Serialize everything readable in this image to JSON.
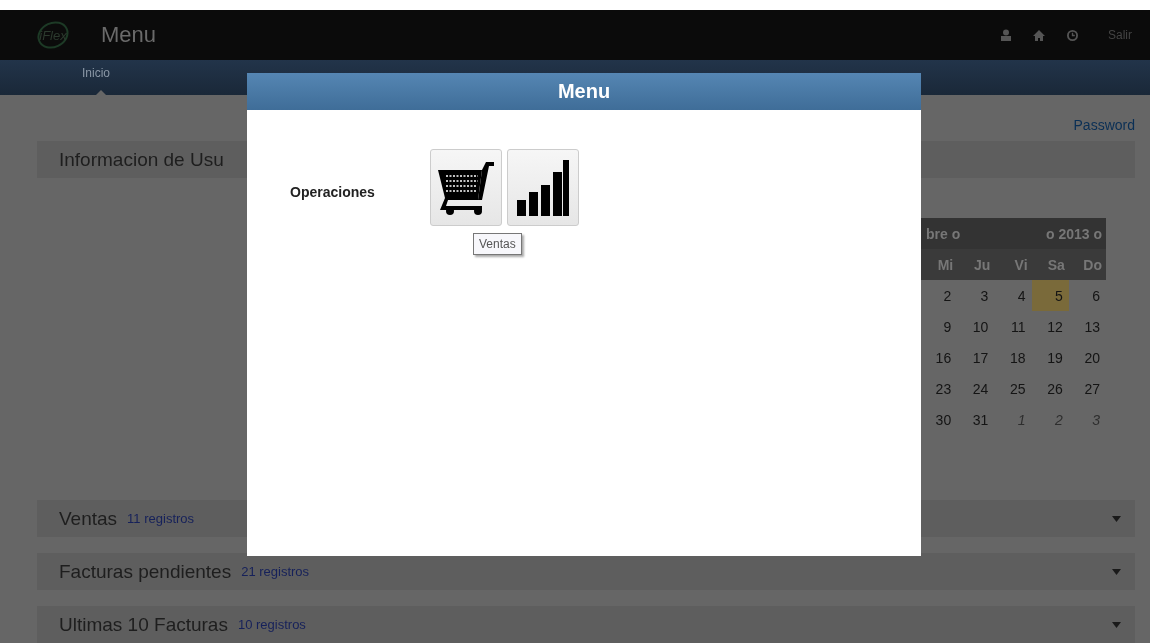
{
  "header": {
    "logo": "iFlex",
    "title": "Menu",
    "actions": [
      {
        "kind": "user"
      },
      {
        "kind": "home"
      },
      {
        "kind": "clock"
      },
      {
        "kind": "text",
        "label": "Salir"
      }
    ]
  },
  "tabs": [
    {
      "label": "Inicio",
      "selected": true
    }
  ],
  "password_link": "Password",
  "info_panel": {
    "title": "Informacion de Usu"
  },
  "calendar": {
    "month": "bre o",
    "year": "o 2013 o",
    "weekdays": [
      "Mi",
      "Ju",
      "Vi",
      "Sa",
      "Do"
    ],
    "weeks": [
      [
        {
          "day": "2",
          "other_month": false,
          "selected": false
        },
        {
          "day": "3",
          "other_month": false,
          "selected": false
        },
        {
          "day": "4",
          "other_month": false,
          "selected": false
        },
        {
          "day": "5",
          "other_month": false,
          "selected": true
        },
        {
          "day": "6",
          "other_month": false,
          "selected": false
        }
      ],
      [
        {
          "day": "9",
          "other_month": false,
          "selected": false
        },
        {
          "day": "10",
          "other_month": false,
          "selected": false
        },
        {
          "day": "11",
          "other_month": false,
          "selected": false
        },
        {
          "day": "12",
          "other_month": false,
          "selected": false
        },
        {
          "day": "13",
          "other_month": false,
          "selected": false
        }
      ],
      [
        {
          "day": "16",
          "other_month": false,
          "selected": false
        },
        {
          "day": "17",
          "other_month": false,
          "selected": false
        },
        {
          "day": "18",
          "other_month": false,
          "selected": false
        },
        {
          "day": "19",
          "other_month": false,
          "selected": false
        },
        {
          "day": "20",
          "other_month": false,
          "selected": false
        }
      ],
      [
        {
          "day": "23",
          "other_month": false,
          "selected": false
        },
        {
          "day": "24",
          "other_month": false,
          "selected": false
        },
        {
          "day": "25",
          "other_month": false,
          "selected": false
        },
        {
          "day": "26",
          "other_month": false,
          "selected": false
        },
        {
          "day": "27",
          "other_month": false,
          "selected": false
        }
      ],
      [
        {
          "day": "30",
          "other_month": false,
          "selected": false
        },
        {
          "day": "31",
          "other_month": false,
          "selected": false
        },
        {
          "day": "1",
          "other_month": true,
          "selected": false
        },
        {
          "day": "2",
          "other_month": true,
          "selected": false
        },
        {
          "day": "3",
          "other_month": true,
          "selected": false
        }
      ]
    ]
  },
  "sections": [
    {
      "title": "Ventas",
      "count": "11 registros"
    },
    {
      "title": "Facturas pendientes",
      "count": "21 registros"
    },
    {
      "title": "Ultimas 10 Facturas",
      "count": "10 registros"
    }
  ],
  "modal": {
    "title": "Menu",
    "groups": [
      {
        "label": "Operaciones",
        "buttons": [
          {
            "kind": "cart",
            "tooltip": "Ventas"
          },
          {
            "kind": "bars"
          }
        ]
      }
    ]
  }
}
